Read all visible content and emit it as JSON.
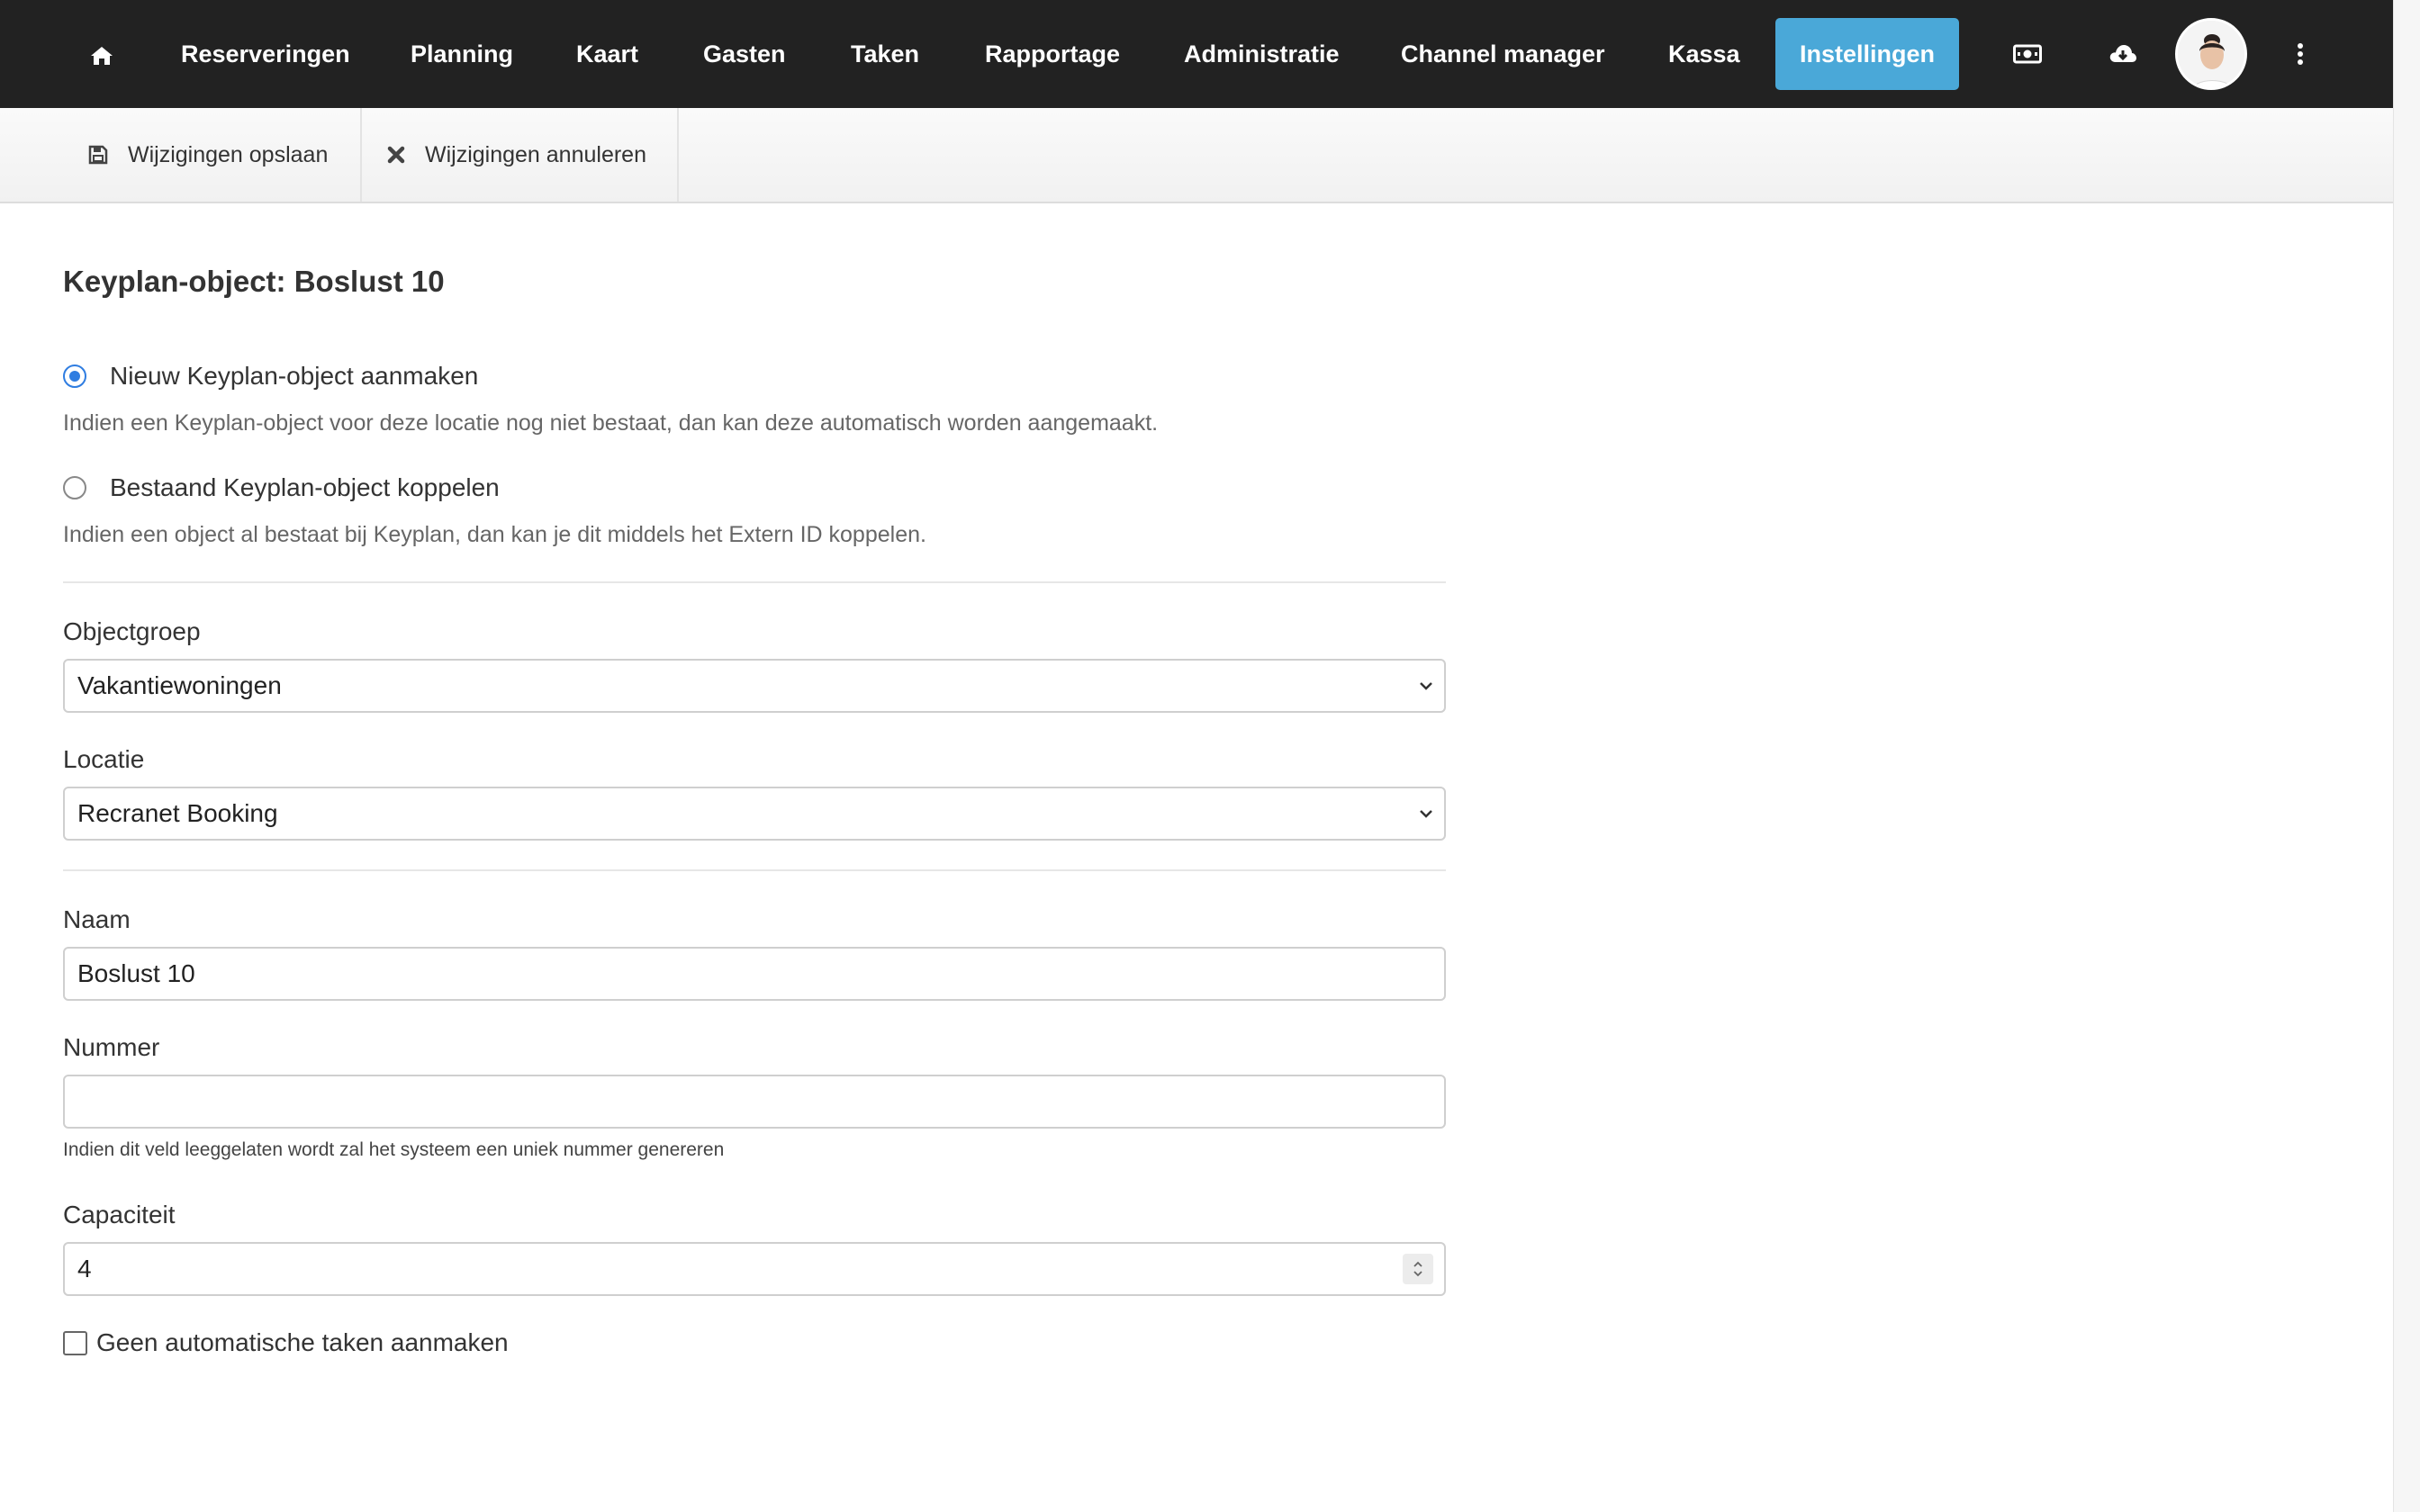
{
  "nav": {
    "home_icon": "home-icon",
    "items": [
      {
        "label": "Reserveringen"
      },
      {
        "label": "Planning"
      },
      {
        "label": "Kaart"
      },
      {
        "label": "Gasten"
      },
      {
        "label": "Taken"
      },
      {
        "label": "Rapportage"
      },
      {
        "label": "Administratie"
      },
      {
        "label": "Channel manager"
      },
      {
        "label": "Kassa"
      },
      {
        "label": "Instellingen",
        "active": true
      }
    ],
    "icons": [
      "money-icon",
      "cloud-download-icon",
      "avatar",
      "more-vertical-icon"
    ],
    "active_color": "#4aa8d8",
    "bg_color": "#222222"
  },
  "toolbar": {
    "save_label": "Wijzigingen opslaan",
    "save_icon": "save-icon",
    "cancel_label": "Wijzigingen annuleren",
    "cancel_icon": "close-icon"
  },
  "form": {
    "title": "Keyplan-object: Boslust 10",
    "option_new": {
      "label": "Nieuw Keyplan-object aanmaken",
      "help": "Indien een Keyplan-object voor deze locatie nog niet bestaat, dan kan deze automatisch worden aangemaakt.",
      "checked": true
    },
    "option_existing": {
      "label": "Bestaand Keyplan-object koppelen",
      "help": "Indien een object al bestaat bij Keyplan, dan kan je dit middels het Extern ID koppelen.",
      "checked": false
    },
    "objectgroep": {
      "label": "Objectgroep",
      "value": "Vakantiewoningen"
    },
    "locatie": {
      "label": "Locatie",
      "value": "Recranet Booking"
    },
    "naam": {
      "label": "Naam",
      "value": "Boslust 10"
    },
    "nummer": {
      "label": "Nummer",
      "value": "",
      "help": "Indien dit veld leeggelaten wordt zal het systeem een uniek nummer genereren"
    },
    "capaciteit": {
      "label": "Capaciteit",
      "value": "4"
    },
    "no_auto_tasks": {
      "label": "Geen automatische taken aanmaken",
      "checked": false
    }
  }
}
